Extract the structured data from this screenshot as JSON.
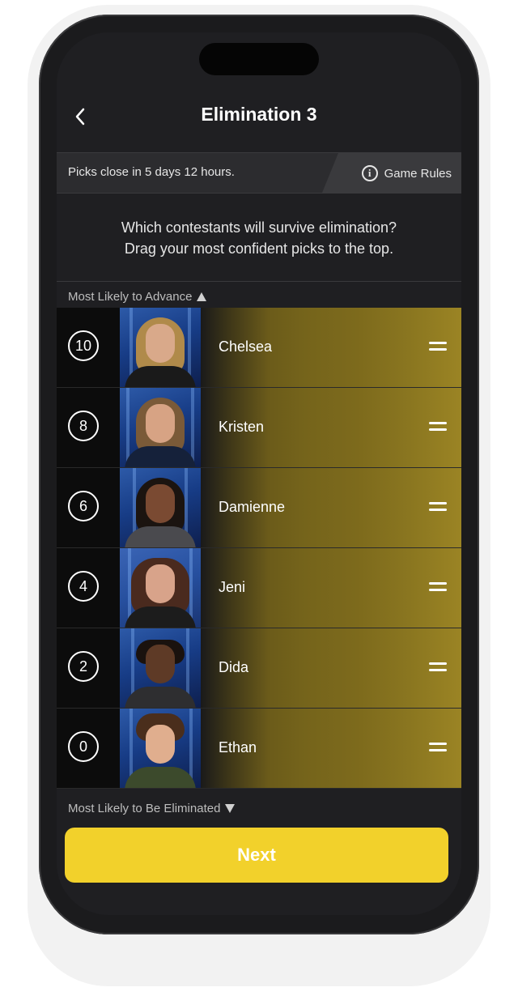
{
  "header": {
    "title": "Elimination 3"
  },
  "deadline": {
    "text": "Picks close in 5 days 12 hours.",
    "rules_label": "Game Rules"
  },
  "instructions": {
    "line1": "Which contestants will survive elimination?",
    "line2": "Drag your most confident picks to the top."
  },
  "sections": {
    "top_label": "Most Likely to Advance",
    "bottom_label": "Most Likely to Be Eliminated"
  },
  "contestants": [
    {
      "rank": "10",
      "name": "Chelsea"
    },
    {
      "rank": "8",
      "name": "Kristen"
    },
    {
      "rank": "6",
      "name": "Damienne"
    },
    {
      "rank": "4",
      "name": "Jeni"
    },
    {
      "rank": "2",
      "name": "Dida"
    },
    {
      "rank": "0",
      "name": "Ethan"
    }
  ],
  "footer": {
    "next_label": "Next"
  },
  "colors": {
    "accent": "#f2d12b",
    "row_gold": "#7d6a1c",
    "background": "#1f1f22"
  }
}
